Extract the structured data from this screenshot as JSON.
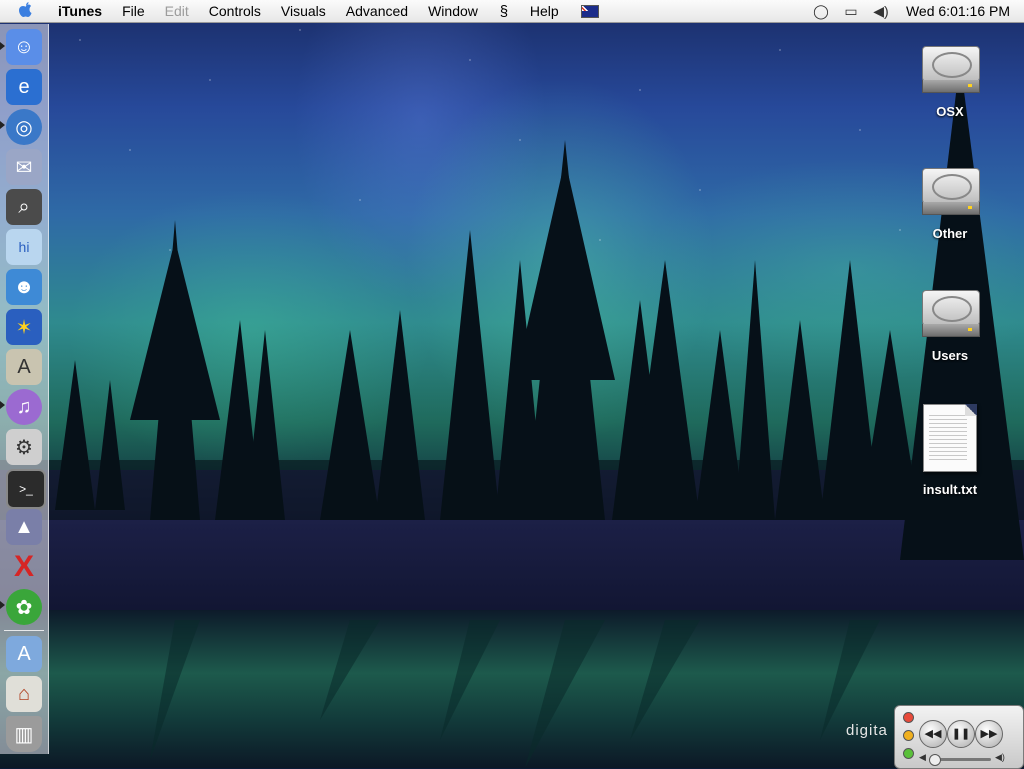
{
  "menubar": {
    "apple_icon": "apple-icon",
    "app_name": "iTunes",
    "items": [
      {
        "label": "File",
        "enabled": true
      },
      {
        "label": "Edit",
        "enabled": false
      },
      {
        "label": "Controls",
        "enabled": true
      },
      {
        "label": "Visuals",
        "enabled": true
      },
      {
        "label": "Advanced",
        "enabled": true
      },
      {
        "label": "Window",
        "enabled": true
      }
    ],
    "script_icon": "script-menu-icon",
    "help_label": "Help",
    "input_flag": "australian-flag-icon",
    "status_icons": [
      "speech-bubble-icon",
      "display-icon",
      "volume-icon"
    ],
    "clock": "Wed 6:01:16 PM"
  },
  "dock": {
    "items": [
      {
        "name": "finder-icon",
        "color": "#5a8ee8"
      },
      {
        "name": "internet-explorer-icon",
        "color": "#2b6fd1"
      },
      {
        "name": "network-globe-icon",
        "color": "#3a78c8"
      },
      {
        "name": "mail-icon",
        "color": "#9aa6c6"
      },
      {
        "name": "sherlock-icon",
        "color": "#4b4b4b"
      },
      {
        "name": "hi-icon",
        "color": "#b9d6ef"
      },
      {
        "name": "messenger-icon",
        "color": "#3e8ad6"
      },
      {
        "name": "aim-icon",
        "color": "#2a5fbf"
      },
      {
        "name": "textedit-icon",
        "color": "#c9c4b0"
      },
      {
        "name": "itunes-icon",
        "color": "#9b6ad1"
      },
      {
        "name": "system-preferences-icon",
        "color": "#cfcfcf"
      },
      {
        "name": "terminal-icon",
        "color": "#2b2b2b"
      },
      {
        "name": "rocket-icon",
        "color": "#7a7fa8"
      },
      {
        "name": "x11-icon",
        "color": "#d62525"
      },
      {
        "name": "gear-icon",
        "color": "#3aa63a"
      },
      {
        "name": "applications-folder-icon",
        "color": "#7ea9dd"
      },
      {
        "name": "home-icon",
        "color": "#e0dfd8"
      },
      {
        "name": "trash-icon",
        "color": "#9b9b9b"
      }
    ]
  },
  "desktop": {
    "icons": [
      {
        "label": "OSX",
        "type": "drive"
      },
      {
        "label": "Other",
        "type": "drive"
      },
      {
        "label": "Users",
        "type": "drive"
      },
      {
        "label": "insult.txt",
        "type": "document"
      }
    ]
  },
  "miniplayer": {
    "title_fragment": "digita",
    "buttons": [
      "rewind-icon",
      "pause-icon",
      "fast-forward-icon"
    ]
  }
}
